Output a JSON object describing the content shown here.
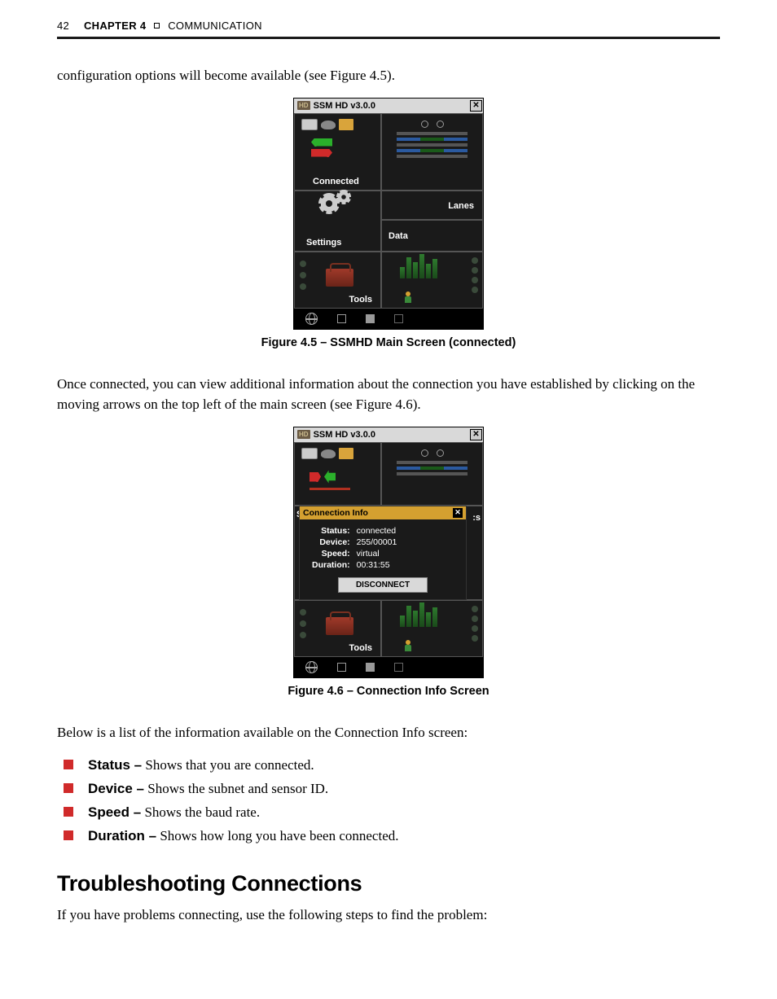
{
  "header": {
    "page_number": "42",
    "chapter_label": "CHAPTER 4",
    "chapter_title": "COMMUNICATION"
  },
  "para1": "configuration options will become available (see Figure 4.5).",
  "fig45": {
    "window_title": "SSM HD v3.0.0",
    "connected_label": "Connected",
    "settings_label": "Settings",
    "lanes_label": "Lanes",
    "data_label": "Data",
    "tools_label": "Tools",
    "caption": "Figure 4.5 – SSMHD Main Screen (connected)"
  },
  "para2": "Once connected, you can view additional information about the connection you have established by clicking on the moving arrows on the top left of the main screen (see Figure 4.6).",
  "fig46": {
    "window_title": "SSM HD v3.0.0",
    "conn_info_title": "Connection Info",
    "rows": {
      "status_label": "Status:",
      "status_value": "connected",
      "device_label": "Device:",
      "device_value": "255/00001",
      "speed_label": "Speed:",
      "speed_value": "virtual",
      "duration_label": "Duration:",
      "duration_value": "00:31:55"
    },
    "disconnect_label": "DISCONNECT",
    "tools_label": "Tools",
    "side_s": "S",
    "side_es": ":s",
    "caption": "Figure 4.6 – Connection Info Screen"
  },
  "para3": "Below is a list of the information available on the Connection Info screen:",
  "list": {
    "items": [
      {
        "term": "Status –",
        "desc": " Shows that you are connected."
      },
      {
        "term": "Device –",
        "desc": " Shows the subnet and sensor ID."
      },
      {
        "term": "Speed –",
        "desc": " Shows the baud rate."
      },
      {
        "term": "Duration –",
        "desc": " Shows how long you have been connected."
      }
    ]
  },
  "section_heading": "Troubleshooting Connections",
  "para4": "If you have problems connecting, use the following steps to find the problem:"
}
